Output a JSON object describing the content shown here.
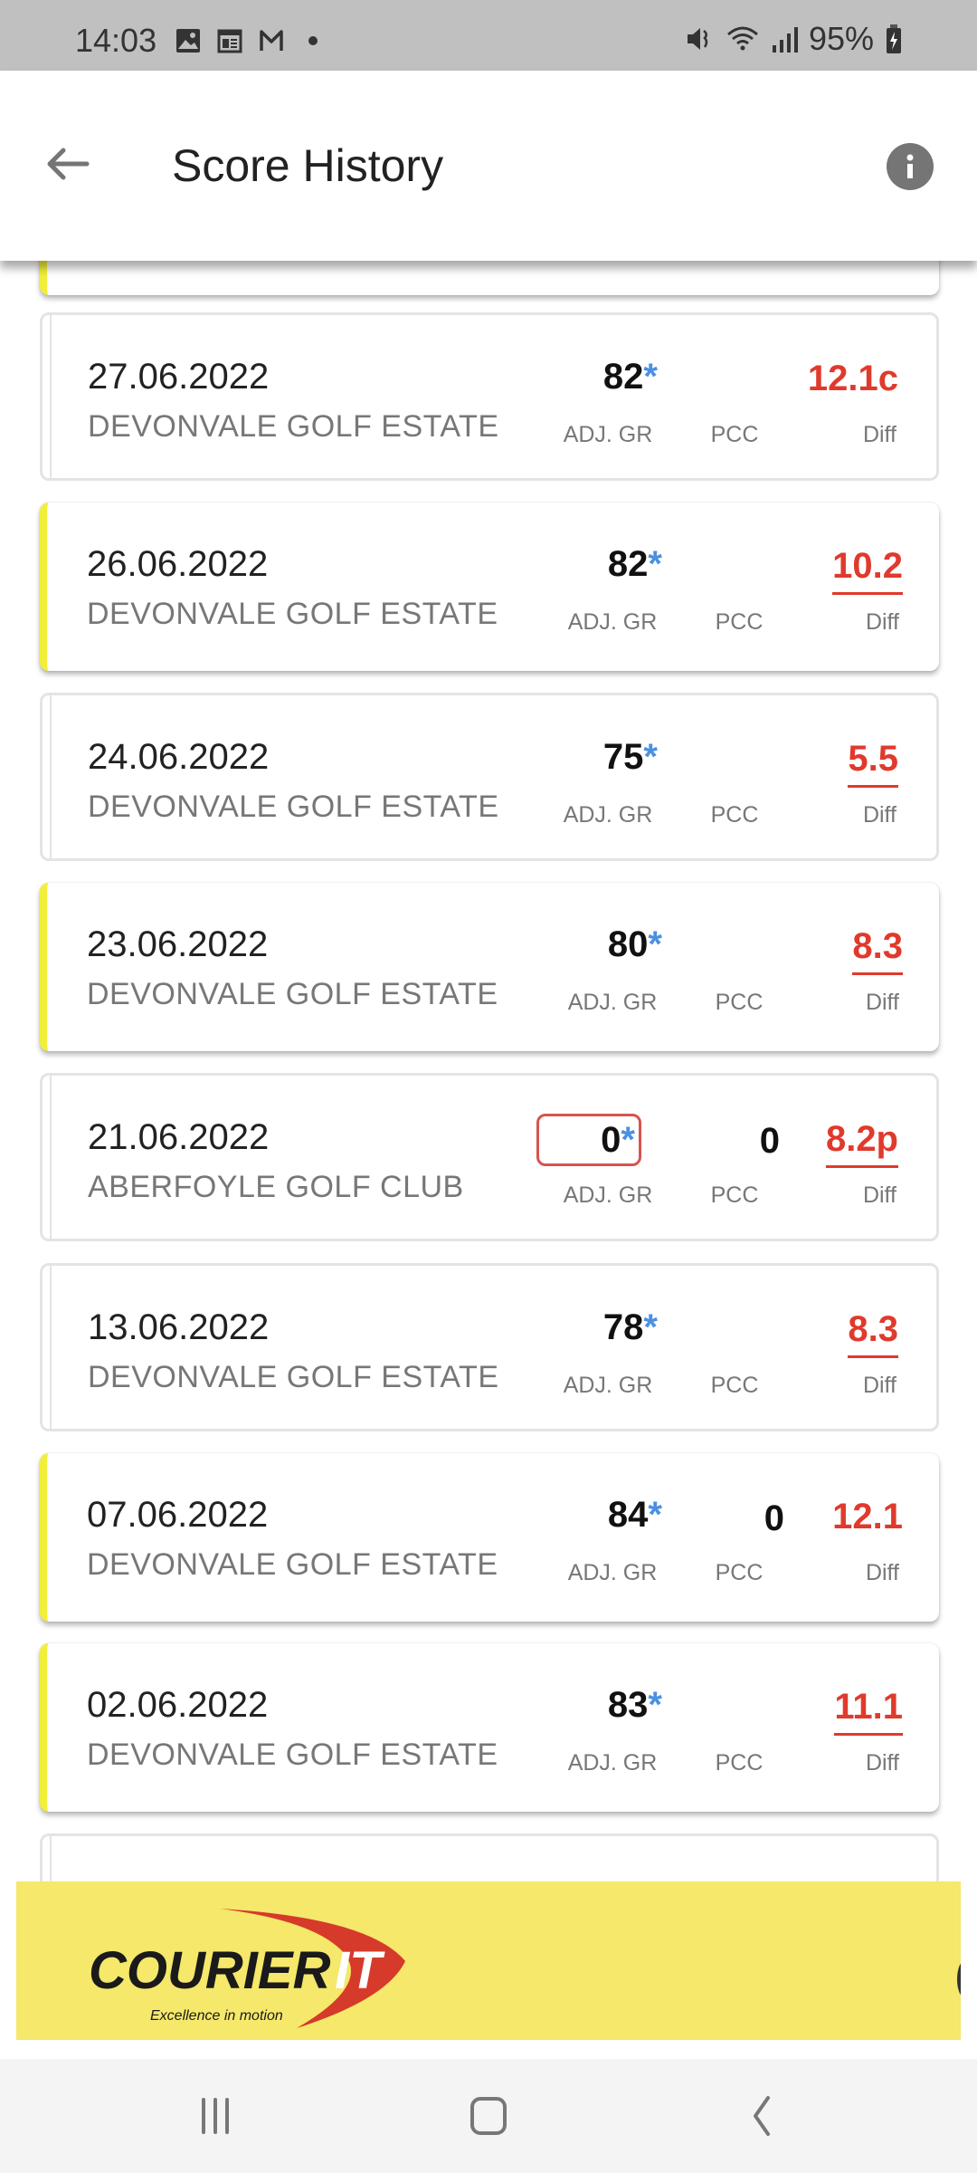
{
  "status_bar": {
    "time": "14:03",
    "left_icons": [
      "gallery-icon",
      "calendar-news-icon",
      "gmail-icon",
      "notification-dot"
    ],
    "right_icons": [
      "mute-icon",
      "wifi-icon",
      "signal-icon"
    ],
    "battery": "95%"
  },
  "app_bar": {
    "title": "Score History",
    "back_icon": "arrow-left-icon",
    "info_icon": "info-icon"
  },
  "labels": {
    "adj_gr": "ADJ. GR",
    "pcc": "PCC",
    "diff": "Diff",
    "star": "*"
  },
  "colors": {
    "accent_yellow": "#f2ef3a",
    "diff_red": "#e03a2c",
    "star_blue": "#4a90e2",
    "ad_yellow": "#f5e86a"
  },
  "rounds": [
    {
      "date": "27.06.2022",
      "club": "DEVONVALE GOLF ESTATE",
      "adj_gr": "82",
      "pcc": "",
      "diff": "12.1c",
      "diff_underlined": false,
      "counting": false,
      "adj_boxed": false
    },
    {
      "date": "26.06.2022",
      "club": "DEVONVALE GOLF ESTATE",
      "adj_gr": "82",
      "pcc": "",
      "diff": "10.2",
      "diff_underlined": true,
      "counting": true,
      "adj_boxed": false
    },
    {
      "date": "24.06.2022",
      "club": "DEVONVALE GOLF ESTATE",
      "adj_gr": "75",
      "pcc": "",
      "diff": "5.5",
      "diff_underlined": true,
      "counting": false,
      "adj_boxed": false
    },
    {
      "date": "23.06.2022",
      "club": "DEVONVALE GOLF ESTATE",
      "adj_gr": "80",
      "pcc": "",
      "diff": "8.3",
      "diff_underlined": true,
      "counting": true,
      "adj_boxed": false
    },
    {
      "date": "21.06.2022",
      "club": "ABERFOYLE GOLF CLUB",
      "adj_gr": "0",
      "pcc": "0",
      "diff": "8.2p",
      "diff_underlined": true,
      "counting": false,
      "adj_boxed": true
    },
    {
      "date": "13.06.2022",
      "club": "DEVONVALE GOLF ESTATE",
      "adj_gr": "78",
      "pcc": "",
      "diff": "8.3",
      "diff_underlined": true,
      "counting": false,
      "adj_boxed": false
    },
    {
      "date": "07.06.2022",
      "club": "DEVONVALE GOLF ESTATE",
      "adj_gr": "84",
      "pcc": "0",
      "diff": "12.1",
      "diff_underlined": false,
      "counting": true,
      "adj_boxed": false
    },
    {
      "date": "02.06.2022",
      "club": "DEVONVALE GOLF ESTATE",
      "adj_gr": "83",
      "pcc": "",
      "diff": "11.1",
      "diff_underlined": true,
      "counting": true,
      "adj_boxed": false
    }
  ],
  "ad_banner": {
    "brand": "COURIER",
    "brand_suffix": "IT",
    "tagline": "Excellence in motion"
  },
  "nav_bar": {
    "recents_icon": "recent-apps-icon",
    "home_icon": "home-icon",
    "back_icon": "back-icon"
  }
}
